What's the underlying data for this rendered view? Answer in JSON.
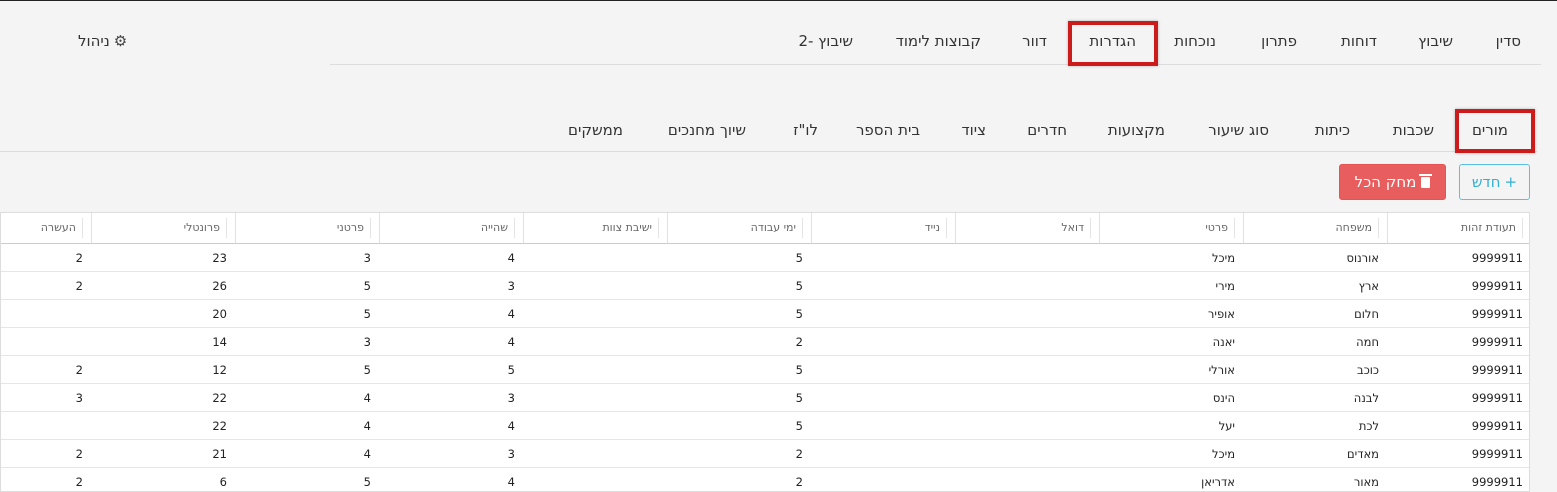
{
  "admin": {
    "label": "ניהול",
    "icon": "gear-icon"
  },
  "main_nav": [
    "סדין",
    "שיבוץ",
    "דוחות",
    "פתרון",
    "נוכחות",
    "הגדרות",
    "דוור",
    "קבוצות לימוד",
    "שיבוץ -2"
  ],
  "main_nav_active": "הגדרות",
  "sub_nav": [
    "מורים",
    "שכבות",
    "כיתות",
    "סוג שיעור",
    "מקצועות",
    "חדרים",
    "ציוד",
    "בית הספר",
    "לו\"ז",
    "שיוך מחנכים",
    "ממשקים"
  ],
  "sub_nav_active": "מורים",
  "buttons": {
    "new": "חדש",
    "new_icon": "plus-icon",
    "clear_all": "מחק הכל",
    "clear_all_icon": "trash-icon"
  },
  "colors": {
    "highlight": "#cc1b1b",
    "danger": "#e85d5d",
    "info": "#5bc0de"
  },
  "table": {
    "columns": [
      "תעודת זהות",
      "משפחה",
      "פרטי",
      "דואל",
      "נייד",
      "ימי עבודה",
      "ישיבת צוות",
      "שהייה",
      "פרטני",
      "פרונטלי",
      "העשרה"
    ],
    "rows": [
      [
        "9999911",
        "אורנוס",
        "מיכל",
        "",
        "",
        "5",
        "",
        "4",
        "3",
        "23",
        "2"
      ],
      [
        "9999911",
        "ארץ",
        "מירי",
        "",
        "",
        "5",
        "",
        "3",
        "5",
        "26",
        "2"
      ],
      [
        "9999911",
        "חלום",
        "אופיר",
        "",
        "",
        "5",
        "",
        "4",
        "5",
        "20",
        ""
      ],
      [
        "9999911",
        "חמה",
        "יאנה",
        "",
        "",
        "2",
        "",
        "4",
        "3",
        "14",
        ""
      ],
      [
        "9999911",
        "כוכב",
        "אורלי",
        "",
        "",
        "5",
        "",
        "5",
        "5",
        "12",
        "2"
      ],
      [
        "9999911",
        "לבנה",
        "הינס",
        "",
        "",
        "5",
        "",
        "3",
        "4",
        "22",
        "3"
      ],
      [
        "9999911",
        "לכת",
        "יעל",
        "",
        "",
        "5",
        "",
        "4",
        "4",
        "22",
        ""
      ],
      [
        "9999911",
        "מאדים",
        "מיכל",
        "",
        "",
        "2",
        "",
        "3",
        "4",
        "21",
        "2"
      ],
      [
        "9999911",
        "מאור",
        "אדריאן",
        "",
        "",
        "2",
        "",
        "4",
        "5",
        "6",
        "2"
      ]
    ]
  }
}
